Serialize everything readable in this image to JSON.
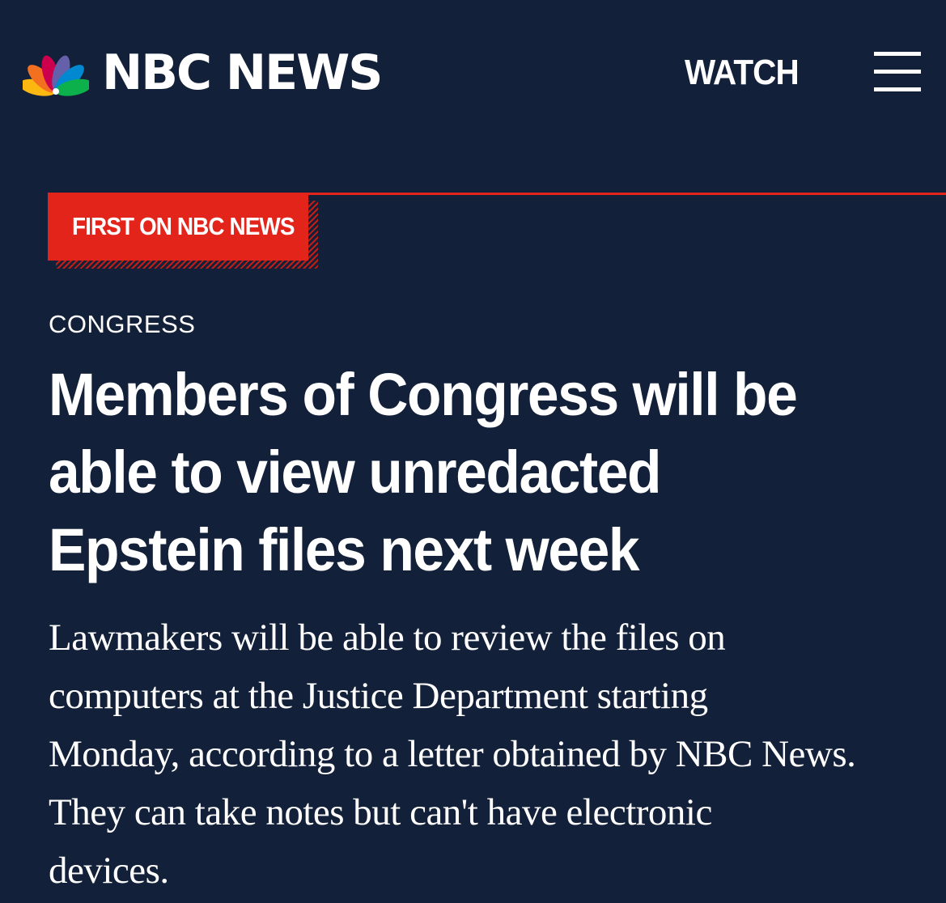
{
  "header": {
    "brand": "NBC NEWS",
    "logo_icon": "nbc-peacock-icon",
    "watch_label": "WATCH",
    "menu_icon": "hamburger-menu-icon"
  },
  "article": {
    "badge": "FIRST ON NBC NEWS",
    "section": "CONGRESS",
    "headline_lines": [
      "Members of Congress will be",
      "able to view unredacted",
      "Epstein files next week"
    ],
    "dek_lines": [
      "Lawmakers will be able to review the files on",
      "computers at the Justice Department starting",
      "Monday, according to a letter obtained by NBC News.",
      "They can take notes but can't have electronic",
      "devices."
    ]
  },
  "colors": {
    "background": "#132039",
    "accent_red": "#e3241b",
    "text": "#ffffff",
    "peacock": [
      "#fcb711",
      "#f37021",
      "#cc004c",
      "#6460aa",
      "#0089d0",
      "#0db14b"
    ]
  }
}
